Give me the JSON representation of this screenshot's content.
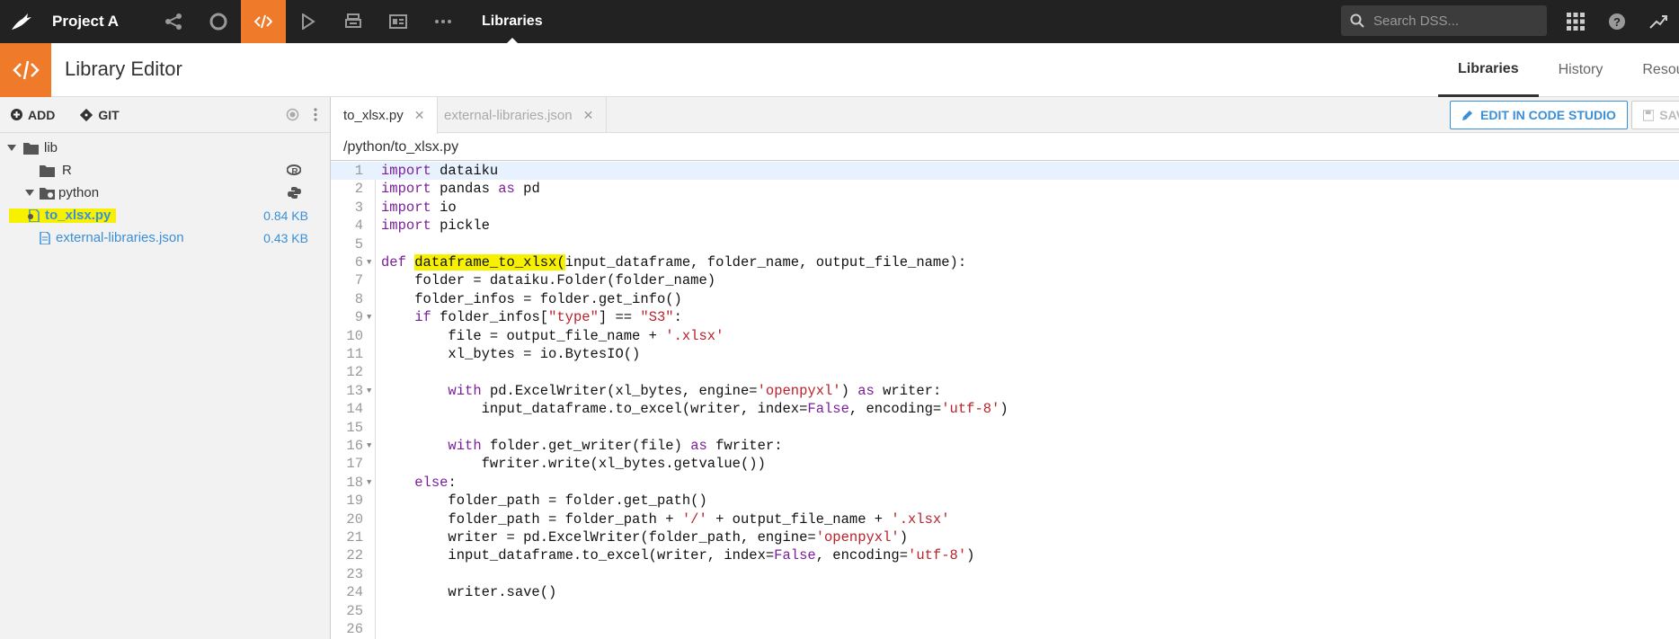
{
  "topnav": {
    "project": "Project A",
    "section": "Libraries",
    "search_placeholder": "Search DSS..."
  },
  "header": {
    "title": "Library Editor",
    "tabs": [
      {
        "label": "Libraries",
        "active": true
      },
      {
        "label": "History",
        "active": false
      },
      {
        "label": "Resour",
        "active": false
      }
    ]
  },
  "sidebar": {
    "add_label": "ADD",
    "git_label": "GIT",
    "tree": [
      {
        "label": "lib",
        "type": "folder",
        "level": 0,
        "expanded": true
      },
      {
        "label": "R",
        "type": "folder",
        "level": 1
      },
      {
        "label": "python",
        "type": "folder",
        "level": 1,
        "expanded": true
      },
      {
        "label": "to_xlsx.py",
        "type": "file",
        "level": 2,
        "size": "0.84 KB",
        "highlighted": true
      },
      {
        "label": "external-libraries.json",
        "type": "file",
        "level": 1,
        "size": "0.43 KB"
      }
    ]
  },
  "editor": {
    "tabs": [
      {
        "label": "to_xlsx.py",
        "active": true
      },
      {
        "label": "external-libraries.json",
        "active": false
      }
    ],
    "edit_in_code_studio": "EDIT IN CODE STUDIO",
    "save_label": "SAV",
    "path": "/python/to_xlsx.py",
    "line_numbers": [
      "1",
      "2",
      "3",
      "4",
      "5",
      "6",
      "7",
      "8",
      "9",
      "10",
      "11",
      "12",
      "13",
      "14",
      "15",
      "16",
      "17",
      "18",
      "19",
      "20",
      "21",
      "22",
      "23",
      "24",
      "25",
      "26"
    ]
  },
  "colors": {
    "accent": "#ee7a2a",
    "topbar": "#222222",
    "link": "#3a8fd8",
    "highlight": "#f7f100"
  }
}
